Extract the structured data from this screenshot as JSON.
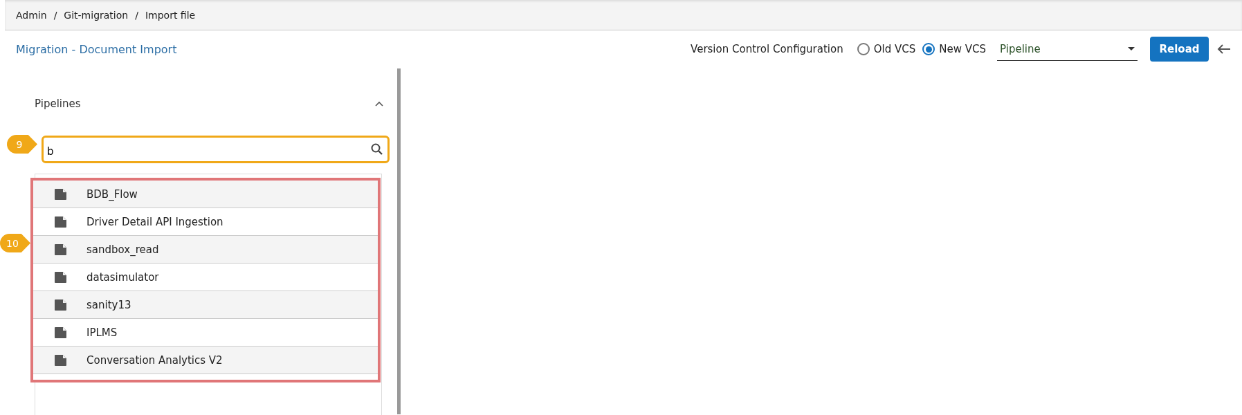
{
  "breadcrumb": [
    "Admin",
    "Git-migration",
    "Import file"
  ],
  "breadcrumb_separator": "/",
  "title": "Migration - Document Import",
  "vcs": {
    "label": "Version Control Configuration",
    "options": [
      {
        "label": "Old VCS",
        "selected": false
      },
      {
        "label": "New VCS",
        "selected": true
      }
    ],
    "dropdown": "Pipeline",
    "button": "Reload"
  },
  "panel": {
    "title": "Pipelines",
    "expanded": true,
    "search": {
      "value": "b"
    },
    "items": [
      "BDB_Flow",
      "Driver Detail API Ingestion",
      "sandbox_read",
      "datasimulator",
      "sanity13",
      "IPLMS",
      "Conversation Analytics V2"
    ]
  },
  "callouts": [
    "9",
    "10"
  ]
}
